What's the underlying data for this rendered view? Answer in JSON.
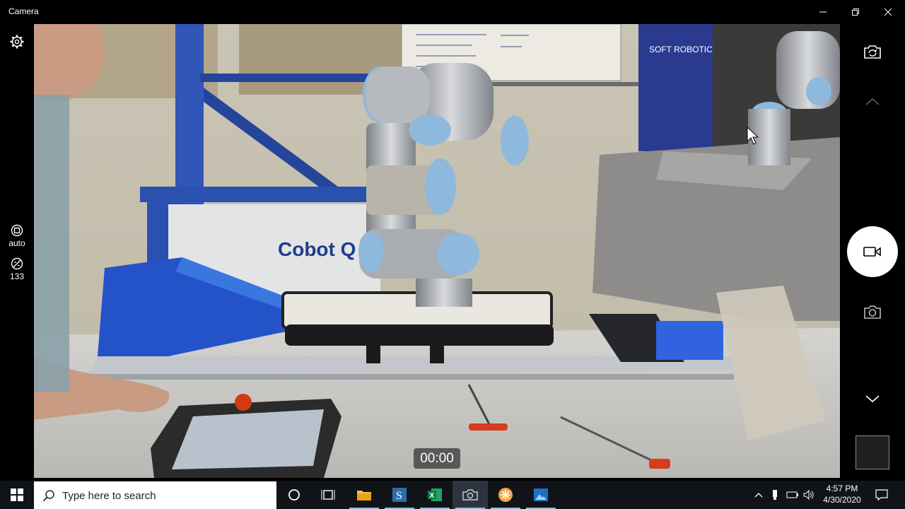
{
  "window": {
    "title": "Camera"
  },
  "left_rail": {
    "settings_icon": "gear-icon",
    "exposure_label": "auto",
    "brightness_value": "133"
  },
  "viewport": {
    "scene_text": {
      "cobot_banner": "Cobot Q",
      "soft_robotics_sign": "SOFT ROBOTICS"
    },
    "timer": "00:00"
  },
  "right_rail": {
    "switch_camera_icon": "camera-switch-icon",
    "mode_video_icon": "video-camera-icon",
    "mode_photo_icon": "photo-camera-icon"
  },
  "taskbar": {
    "search_placeholder": "Type here to search",
    "time": "4:57 PM",
    "date": "4/30/2020",
    "apps": [
      "cortana",
      "task-view",
      "file-explorer",
      "sourcetree",
      "excel",
      "camera",
      "app-orange",
      "photos"
    ]
  },
  "colors": {
    "accent": "#0078d7",
    "robot_blue": "#8fb9dc",
    "bench_blue": "#1e4fd0"
  }
}
